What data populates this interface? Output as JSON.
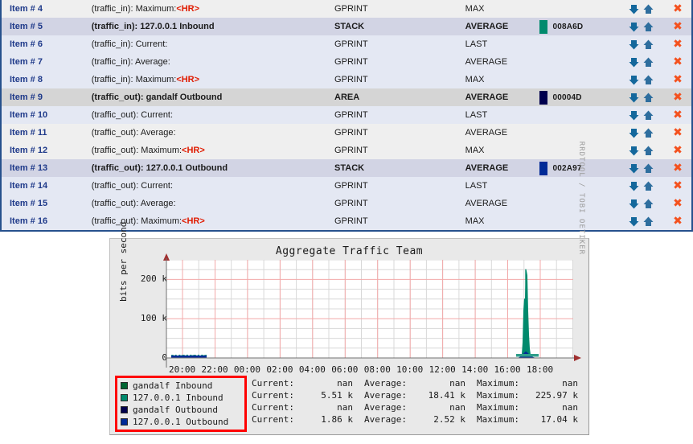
{
  "graph_items": {
    "rows": [
      {
        "item": "Item # 4",
        "desc": "(traffic_in): Maximum:",
        "hr": "<HR>",
        "type": "GPRINT",
        "cf": "MAX",
        "color": "",
        "shade": "shade-light",
        "bold": false
      },
      {
        "item": "Item # 5",
        "desc": "(traffic_in): 127.0.0.1 Inbound",
        "hr": "",
        "type": "STACK",
        "cf": "AVERAGE",
        "color": "008A6D",
        "shade": "shade-lav",
        "bold": true
      },
      {
        "item": "Item # 6",
        "desc": "(traffic_in): Current:",
        "hr": "",
        "type": "GPRINT",
        "cf": "LAST",
        "color": "",
        "shade": "shade-pale",
        "bold": false
      },
      {
        "item": "Item # 7",
        "desc": "(traffic_in): Average:",
        "hr": "",
        "type": "GPRINT",
        "cf": "AVERAGE",
        "color": "",
        "shade": "shade-pale",
        "bold": false
      },
      {
        "item": "Item # 8",
        "desc": "(traffic_in): Maximum:",
        "hr": "<HR>",
        "type": "GPRINT",
        "cf": "MAX",
        "color": "",
        "shade": "shade-pale",
        "bold": false
      },
      {
        "item": "Item # 9",
        "desc": "(traffic_out): gandalf Outbound",
        "hr": "",
        "type": "AREA",
        "cf": "AVERAGE",
        "color": "00004D",
        "shade": "shade-gray",
        "bold": true
      },
      {
        "item": "Item # 10",
        "desc": "(traffic_out): Current:",
        "hr": "",
        "type": "GPRINT",
        "cf": "LAST",
        "color": "",
        "shade": "shade-pale",
        "bold": false
      },
      {
        "item": "Item # 11",
        "desc": "(traffic_out): Average:",
        "hr": "",
        "type": "GPRINT",
        "cf": "AVERAGE",
        "color": "",
        "shade": "shade-light",
        "bold": false
      },
      {
        "item": "Item # 12",
        "desc": "(traffic_out): Maximum:",
        "hr": "<HR>",
        "type": "GPRINT",
        "cf": "MAX",
        "color": "",
        "shade": "shade-light",
        "bold": false
      },
      {
        "item": "Item # 13",
        "desc": "(traffic_out): 127.0.0.1 Outbound",
        "hr": "",
        "type": "STACK",
        "cf": "AVERAGE",
        "color": "002A97",
        "shade": "shade-lav",
        "bold": true
      },
      {
        "item": "Item # 14",
        "desc": "(traffic_out): Current:",
        "hr": "",
        "type": "GPRINT",
        "cf": "LAST",
        "color": "",
        "shade": "shade-pale",
        "bold": false
      },
      {
        "item": "Item # 15",
        "desc": "(traffic_out): Average:",
        "hr": "",
        "type": "GPRINT",
        "cf": "AVERAGE",
        "color": "",
        "shade": "shade-pale",
        "bold": false
      },
      {
        "item": "Item # 16",
        "desc": "(traffic_out): Maximum:",
        "hr": "<HR>",
        "type": "GPRINT",
        "cf": "MAX",
        "color": "",
        "shade": "shade-pale",
        "bold": false
      }
    ],
    "icons": {
      "move_down": "arrow-down-icon",
      "move_up": "arrow-up-icon",
      "delete": "✖"
    }
  },
  "chart_data": {
    "type": "area",
    "title": "Aggregate Traffic Team",
    "xlabel": "",
    "ylabel": "bits per second",
    "ylim": [
      0,
      250000
    ],
    "yticks": [
      "0",
      "100 k",
      "200 k"
    ],
    "ytick_values": [
      0,
      100000,
      200000
    ],
    "xticks": [
      "20:00",
      "22:00",
      "00:00",
      "02:00",
      "04:00",
      "06:00",
      "08:00",
      "10:00",
      "12:00",
      "14:00",
      "16:00",
      "18:00"
    ],
    "grid": true,
    "legend_position": "bottom-left",
    "watermark": "RRDTOOL / TOBI OETIKER",
    "series": [
      {
        "name": "gandalf Inbound",
        "color": "#006633",
        "current": "nan",
        "average": "nan",
        "maximum": "nan",
        "values": []
      },
      {
        "name": "127.0.0.1 Inbound",
        "color": "#008A6D",
        "current": "5.51 k",
        "average": "18.41 k",
        "maximum": "225.97 k",
        "peak_time": "18:45",
        "peak_value": 225970
      },
      {
        "name": "gandalf Outbound",
        "color": "#00004D",
        "current": "nan",
        "average": "nan",
        "maximum": "nan",
        "values": []
      },
      {
        "name": "127.0.0.1 Outbound",
        "color": "#002A97",
        "current": "1.86 k",
        "average": "2.52 k",
        "maximum": "17.04 k",
        "peak_time": "18:45",
        "peak_value": 17040
      }
    ],
    "stat_labels": {
      "current": "Current:",
      "average": "Average:",
      "maximum": "Maximum:"
    }
  }
}
